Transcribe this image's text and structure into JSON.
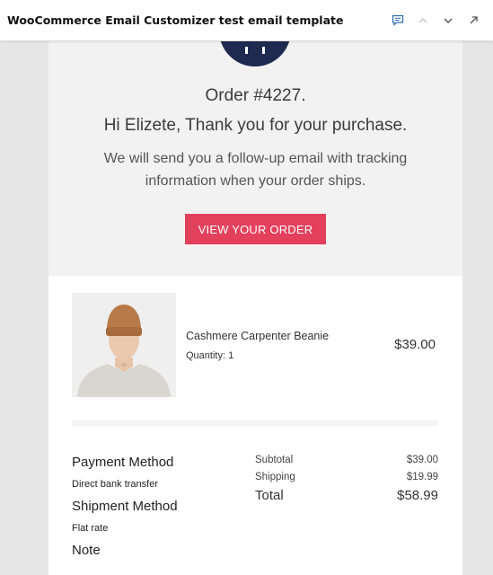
{
  "topbar": {
    "title": "WooCommerce Email Customizer test email template",
    "icons": [
      "comment-icon",
      "chevron-up-icon",
      "chevron-down-icon",
      "open-external-icon"
    ]
  },
  "hero": {
    "order_number": "Order #4227.",
    "thanks": "Hi Elizete, Thank you for your purchase.",
    "followup": "We will send you a follow-up email with tracking information when your order ships.",
    "cta_label": "VIEW YOUR ORDER"
  },
  "product": {
    "name": "Cashmere Carpenter Beanie",
    "quantity": "Quantity: 1",
    "price": "$39.00"
  },
  "payment": {
    "title": "Payment Method",
    "value": "Direct bank transfer"
  },
  "shipment": {
    "title": "Shipment Method",
    "value": "Flat rate"
  },
  "note": {
    "title": "Note"
  },
  "totals": {
    "subtotal_label": "Subtotal",
    "subtotal_value": "$39.00",
    "shipping_label": "Shipping",
    "shipping_value": "$19.99",
    "total_label": "Total",
    "total_value": "$58.99"
  },
  "colors": {
    "cta": "#e3405c",
    "logo": "#1e2a4f",
    "hero_bg": "#f2f2f2",
    "page_bg": "#e6e6e6"
  }
}
